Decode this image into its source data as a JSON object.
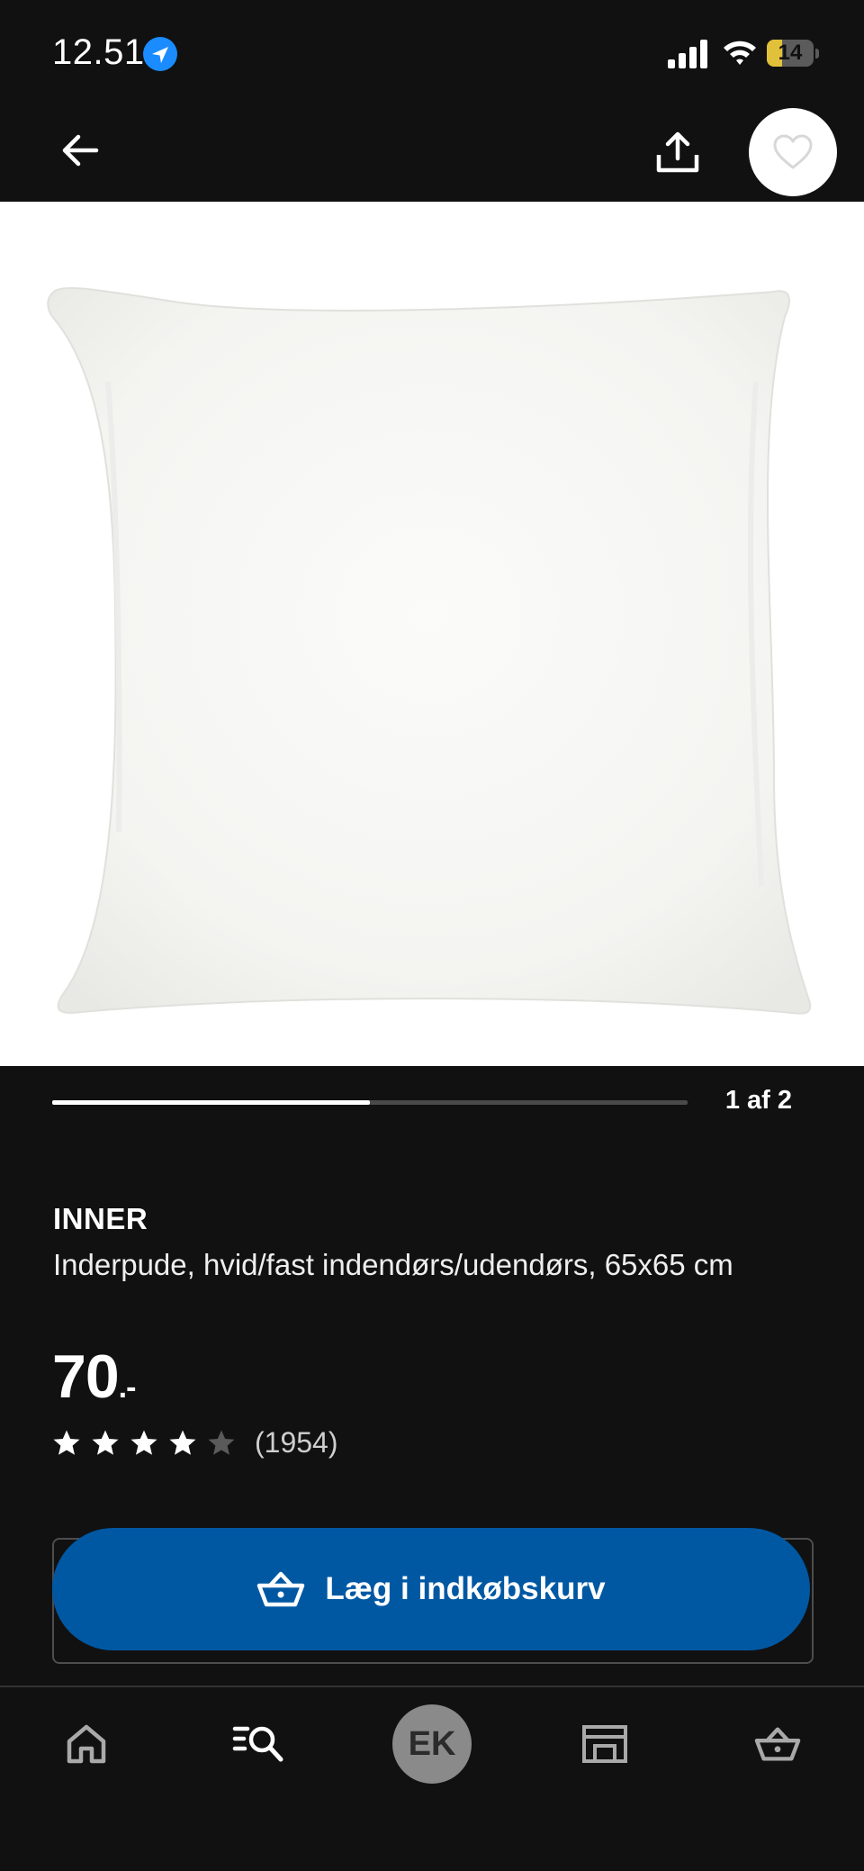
{
  "status_bar": {
    "time": "12.51",
    "battery_level": "14"
  },
  "colors": {
    "background": "#111111",
    "accent_blue": "#0058a3",
    "battery_yellow": "#e2c13a"
  },
  "nav": {
    "back_icon": "arrow-left-icon",
    "share_icon": "share-icon",
    "favorite_icon": "heart-icon"
  },
  "carousel": {
    "counter": "1 af 2",
    "progress": 0.5
  },
  "product": {
    "name": "INNER",
    "description": "Inderpude, hvid/fast indendørs/udendørs, 65x65 cm",
    "price": "70",
    "price_suffix": ".-",
    "rating_stars": 4,
    "rating_max": 5,
    "review_count": "(1954)"
  },
  "cart": {
    "add_label": "Læg i indkøbskurv",
    "icon": "basket-icon"
  },
  "tabbar": {
    "items": [
      {
        "icon": "home-icon"
      },
      {
        "icon": "search-list-icon"
      },
      {
        "avatar_initials": "EK"
      },
      {
        "icon": "store-icon"
      },
      {
        "icon": "basket-icon"
      }
    ]
  }
}
